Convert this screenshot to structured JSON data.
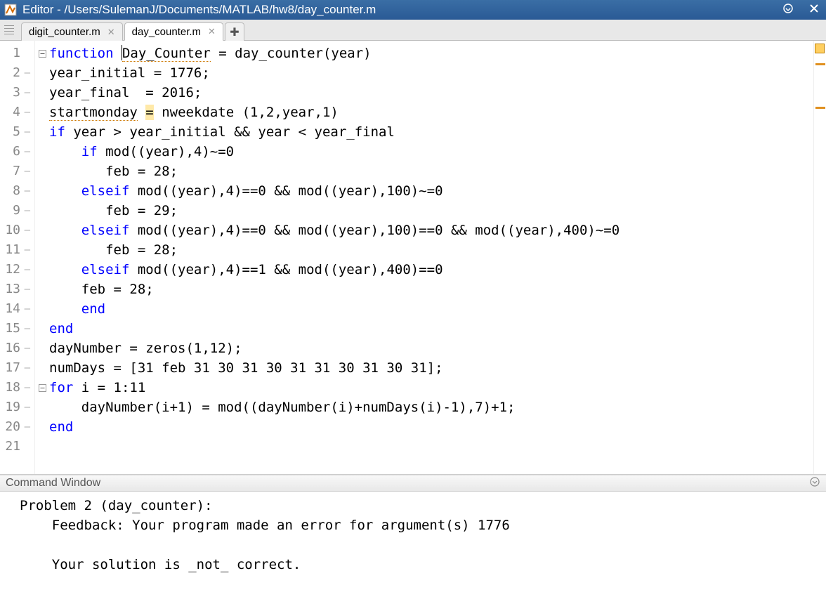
{
  "window": {
    "title": "Editor - /Users/SulemanJ/Documents/MATLAB/hw8/day_counter.m"
  },
  "tabs": [
    {
      "label": "digit_counter.m",
      "active": false
    },
    {
      "label": "day_counter.m",
      "active": true
    }
  ],
  "code": {
    "lines": [
      {
        "n": 1,
        "dash": false,
        "fold": "⊟",
        "tokens": [
          {
            "t": "kw",
            "v": "function"
          },
          {
            "t": "op",
            "v": " "
          },
          {
            "t": "uline",
            "v": "Day_Counter"
          },
          {
            "t": "op",
            "v": " = day_counter(year)"
          }
        ]
      },
      {
        "n": 2,
        "dash": true,
        "fold": "",
        "tokens": [
          {
            "t": "op",
            "v": "year_initial = 1776;"
          }
        ]
      },
      {
        "n": 3,
        "dash": true,
        "fold": "",
        "tokens": [
          {
            "t": "op",
            "v": "year_final  = 2016;"
          }
        ]
      },
      {
        "n": 4,
        "dash": true,
        "fold": "",
        "tokens": [
          {
            "t": "uline",
            "v": "startmonday"
          },
          {
            "t": "op",
            "v": " "
          },
          {
            "t": "warnbg",
            "v": "="
          },
          {
            "t": "op",
            "v": " nweekdate (1,2,year,1)"
          }
        ]
      },
      {
        "n": 5,
        "dash": true,
        "fold": "",
        "tokens": [
          {
            "t": "kw",
            "v": "if"
          },
          {
            "t": "op",
            "v": " year > year_initial && year < year_final"
          }
        ]
      },
      {
        "n": 6,
        "dash": true,
        "fold": "",
        "tokens": [
          {
            "t": "op",
            "v": "    "
          },
          {
            "t": "kw",
            "v": "if"
          },
          {
            "t": "op",
            "v": " mod((year),4)~=0"
          }
        ]
      },
      {
        "n": 7,
        "dash": true,
        "fold": "",
        "tokens": [
          {
            "t": "op",
            "v": "       feb = 28;"
          }
        ]
      },
      {
        "n": 8,
        "dash": true,
        "fold": "",
        "tokens": [
          {
            "t": "op",
            "v": "    "
          },
          {
            "t": "kw",
            "v": "elseif"
          },
          {
            "t": "op",
            "v": " mod((year),4)==0 && mod((year),100)~=0"
          }
        ]
      },
      {
        "n": 9,
        "dash": true,
        "fold": "",
        "tokens": [
          {
            "t": "op",
            "v": "       feb = 29;"
          }
        ]
      },
      {
        "n": 10,
        "dash": true,
        "fold": "",
        "tokens": [
          {
            "t": "op",
            "v": "    "
          },
          {
            "t": "kw",
            "v": "elseif"
          },
          {
            "t": "op",
            "v": " mod((year),4)==0 && mod((year),100)==0 && mod((year),400)~=0"
          }
        ]
      },
      {
        "n": 11,
        "dash": true,
        "fold": "",
        "tokens": [
          {
            "t": "op",
            "v": "       feb = 28;"
          }
        ]
      },
      {
        "n": 12,
        "dash": true,
        "fold": "",
        "tokens": [
          {
            "t": "op",
            "v": "    "
          },
          {
            "t": "kw",
            "v": "elseif"
          },
          {
            "t": "op",
            "v": " mod((year),4)==1 && mod((year),400)==0"
          }
        ]
      },
      {
        "n": 13,
        "dash": true,
        "fold": "",
        "tokens": [
          {
            "t": "op",
            "v": "    feb = 28;"
          }
        ]
      },
      {
        "n": 14,
        "dash": true,
        "fold": "",
        "tokens": [
          {
            "t": "op",
            "v": "    "
          },
          {
            "t": "kw",
            "v": "end"
          }
        ]
      },
      {
        "n": 15,
        "dash": true,
        "fold": "",
        "tokens": [
          {
            "t": "kw",
            "v": "end"
          }
        ]
      },
      {
        "n": 16,
        "dash": true,
        "fold": "",
        "tokens": [
          {
            "t": "op",
            "v": "dayNumber = zeros(1,12);"
          }
        ]
      },
      {
        "n": 17,
        "dash": true,
        "fold": "",
        "tokens": [
          {
            "t": "op",
            "v": "numDays = [31 feb 31 30 31 30 31 31 30 31 30 31];"
          }
        ]
      },
      {
        "n": 18,
        "dash": true,
        "fold": "⊟",
        "tokens": [
          {
            "t": "kw",
            "v": "for"
          },
          {
            "t": "op",
            "v": " i = 1:11"
          }
        ]
      },
      {
        "n": 19,
        "dash": true,
        "fold": "",
        "tokens": [
          {
            "t": "op",
            "v": "    dayNumber(i+1) = mod((dayNumber(i)+numDays(i)-1),7)+1;"
          }
        ]
      },
      {
        "n": 20,
        "dash": true,
        "fold": "└",
        "tokens": [
          {
            "t": "kw",
            "v": "end"
          }
        ]
      },
      {
        "n": 21,
        "dash": false,
        "fold": "",
        "tokens": []
      }
    ]
  },
  "command_window": {
    "title": "Command Window",
    "output": "Problem 2 (day_counter):\n    Feedback: Your program made an error for argument(s) 1776\n\n    Your solution is _not_ correct."
  }
}
